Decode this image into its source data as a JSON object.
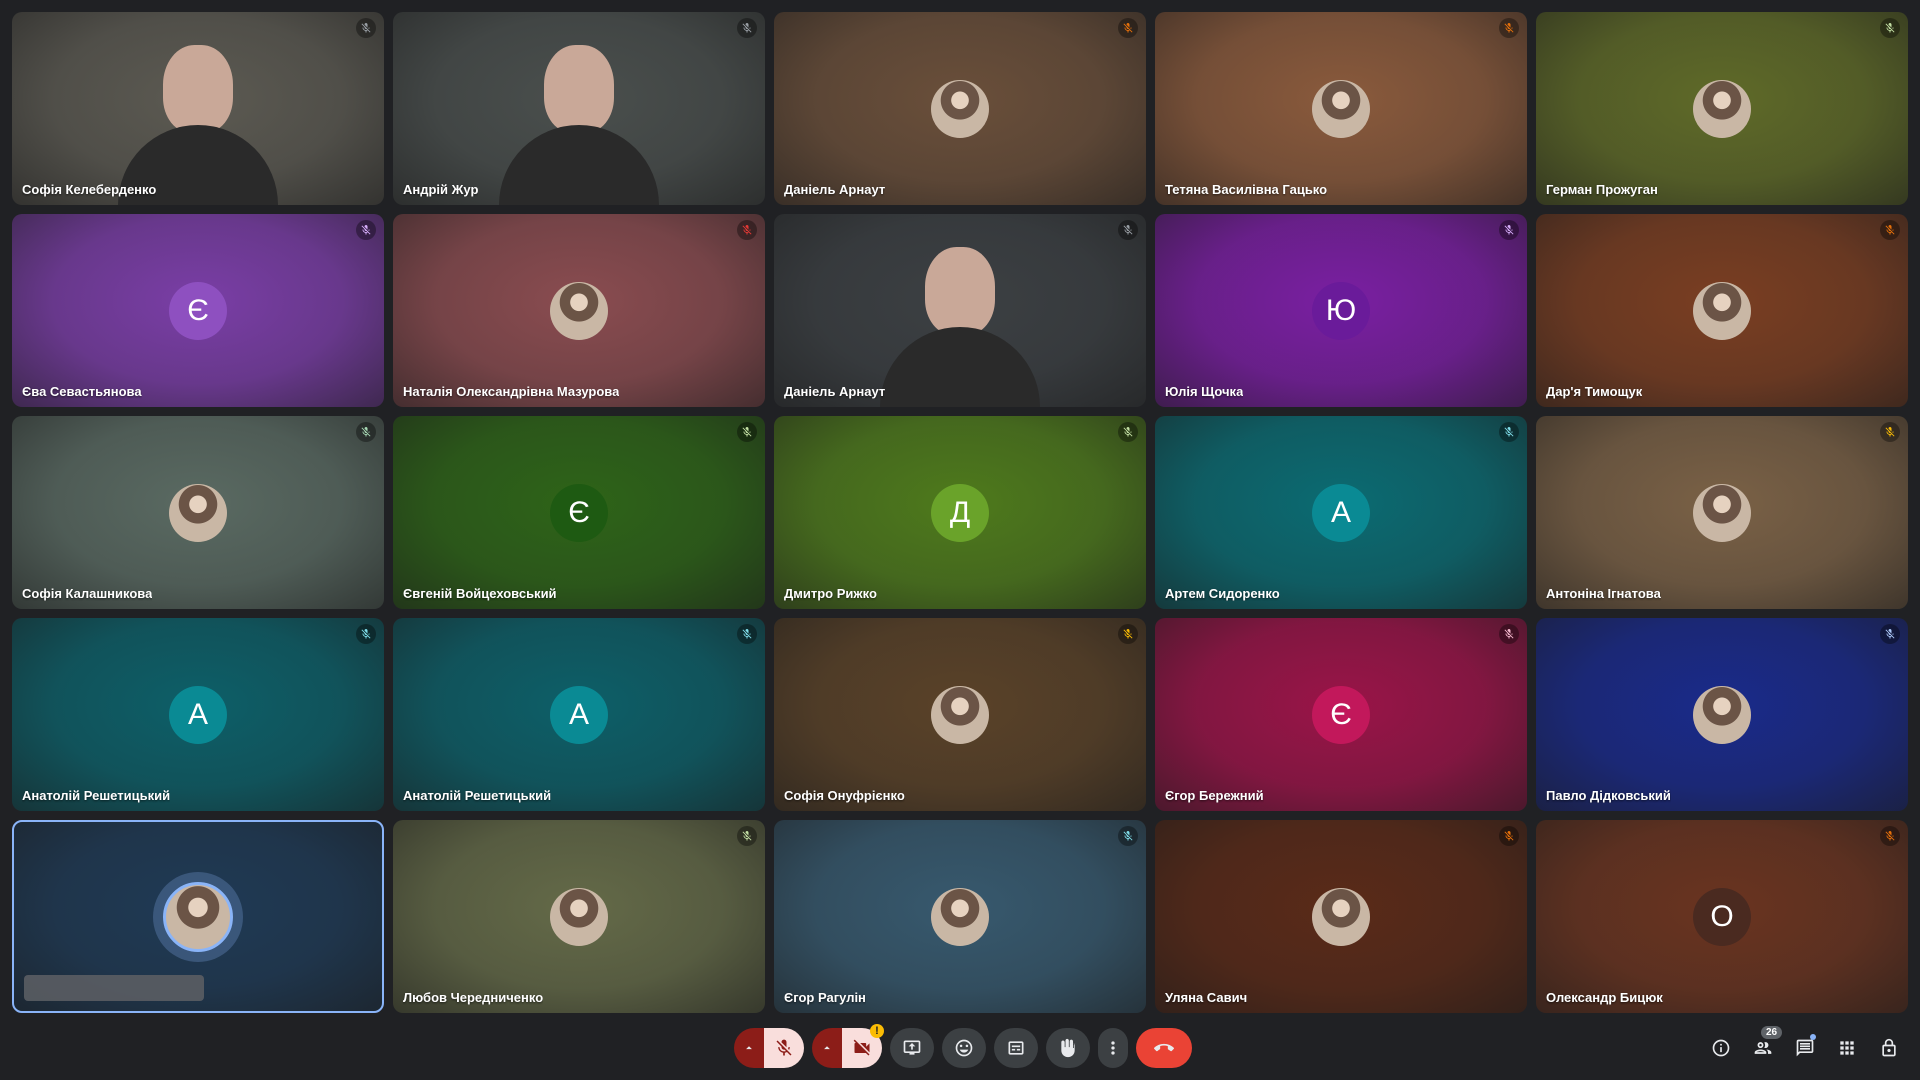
{
  "participants": [
    {
      "name": "Софія Келеберденко",
      "type": "video",
      "bg": "#5c5a52",
      "mic": "#9aa0a6"
    },
    {
      "name": "Андрій Жур",
      "type": "video",
      "bg": "#4a4f4d",
      "mic": "#9aa0a6"
    },
    {
      "name": "Даніель Арнаут",
      "type": "photo",
      "bg": "#6a4f3a",
      "mic": "#e8710a"
    },
    {
      "name": "Тетяна Василівна Гацько",
      "type": "photo",
      "bg": "#8a5a3c",
      "mic": "#e8710a"
    },
    {
      "name": "Герман Прожуган",
      "type": "photo",
      "bg": "#5f6a28",
      "mic": "#c5e1a5"
    },
    {
      "name": "Єва Севастьянова",
      "type": "letter",
      "letter": "Є",
      "bg": "#7a3ea6",
      "avatar_bg": "#8e50c0",
      "mic": "#d7aefb"
    },
    {
      "name": "Наталія Олександрівна Мазурова",
      "type": "photo",
      "bg": "#8a4c50",
      "mic": "#e53935"
    },
    {
      "name": "Даніель Арнаут",
      "type": "video",
      "bg": "#3c4043",
      "mic": "#9aa0a6"
    },
    {
      "name": "Юлія Щочка",
      "type": "letter",
      "letter": "Ю",
      "bg": "#7a1fa2",
      "avatar_bg": "#6a1b9a",
      "mic": "#d7aefb"
    },
    {
      "name": "Дар'я Тимощук",
      "type": "photo",
      "bg": "#7a3e22",
      "mic": "#e8710a"
    },
    {
      "name": "Софія Калашникова",
      "type": "photo",
      "bg": "#5a6a62",
      "mic": "#a8dab5"
    },
    {
      "name": "Євгеній Войцеховський",
      "type": "letter",
      "letter": "Є",
      "bg": "#2e6418",
      "avatar_bg": "#1e5a12",
      "mic": "#c5e1a5"
    },
    {
      "name": "Дмитро Рижко",
      "type": "letter",
      "letter": "Д",
      "bg": "#4e7a1c",
      "avatar_bg": "#6aa32a",
      "mic": "#c5e1a5"
    },
    {
      "name": "Артем Сидоренко",
      "type": "letter",
      "letter": "А",
      "bg": "#0b6b72",
      "avatar_bg": "#0a8a94",
      "mic": "#80deea"
    },
    {
      "name": "Антоніна Ігнатова",
      "type": "photo",
      "bg": "#7a6146",
      "mic": "#fbbc04"
    },
    {
      "name": "Анатолій Решетицький",
      "type": "letter",
      "letter": "А",
      "bg": "#0d5f68",
      "avatar_bg": "#0a8a94",
      "mic": "#80deea"
    },
    {
      "name": "Анатолій Решетицький",
      "type": "letter",
      "letter": "А",
      "bg": "#0d5f68",
      "avatar_bg": "#0a8a94",
      "mic": "#80deea"
    },
    {
      "name": "Софія Онуфрієнко",
      "type": "photo",
      "bg": "#5a4228",
      "mic": "#fbbc04"
    },
    {
      "name": "Єгор Бережний",
      "type": "letter",
      "letter": "Є",
      "bg": "#9a1448",
      "avatar_bg": "#c2185b",
      "mic": "#f8bbd0"
    },
    {
      "name": "Павло Дідковський",
      "type": "photo",
      "bg": "#1a2a8a",
      "mic": "#aecbfa"
    },
    {
      "name": "",
      "type": "ring",
      "bg": "#1f3a55",
      "mic": "",
      "active": true,
      "redacted": true
    },
    {
      "name": "Любов Чередниченко",
      "type": "photo",
      "bg": "#646a48",
      "mic": "#c5e1a5"
    },
    {
      "name": "Єгор Рагулін",
      "type": "photo",
      "bg": "#37596e",
      "mic": "#80deea"
    },
    {
      "name": "Уляна Савич",
      "type": "photo",
      "bg": "#5a2a18",
      "mic": "#e8710a"
    },
    {
      "name": "Олександр Бицюк",
      "type": "letter",
      "letter": "О",
      "bg": "#6a3420",
      "avatar_bg": "#4a2a20",
      "mic": "#e8710a"
    }
  ],
  "toolbar": {
    "participants_count": "26",
    "camera_warning": "!"
  },
  "colors": {
    "background": "#202124",
    "muted_red": "#8c1d18",
    "muted_icon_bg": "#f9dedc",
    "hangup": "#ea4335",
    "accent": "#8ab4f8"
  },
  "icons": [
    "mic-off-icon",
    "camera-off-icon",
    "present-icon",
    "emoji-icon",
    "captions-icon",
    "raise-hand-icon",
    "more-icon",
    "hangup-icon",
    "info-icon",
    "people-icon",
    "chat-icon",
    "apps-icon",
    "host-controls-icon"
  ]
}
